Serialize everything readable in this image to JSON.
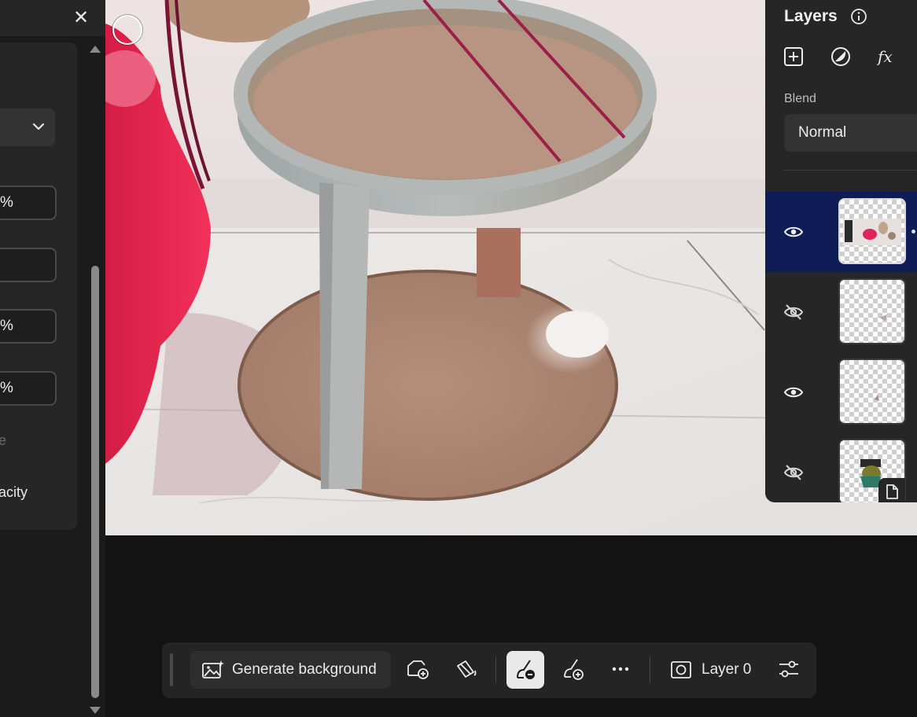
{
  "left_panel": {
    "close_label": "✕",
    "fields": [
      {
        "value": "%"
      },
      {
        "value": ""
      },
      {
        "value": "%"
      },
      {
        "value": "%"
      }
    ],
    "faint_label": "e",
    "opacity_label": "acity"
  },
  "layers_panel": {
    "title": "Layers",
    "blend_label": "Blend",
    "blend_value": "Normal",
    "layers": [
      {
        "visible": true,
        "selected": true
      },
      {
        "visible": false,
        "selected": false
      },
      {
        "visible": true,
        "selected": false
      },
      {
        "visible": false,
        "selected": false
      }
    ]
  },
  "taskbar": {
    "generate_background_label": "Generate background",
    "layer_name": "Layer 0"
  },
  "icons": {
    "close": "close-icon",
    "chevron": "chevron-down-icon",
    "info": "info-icon",
    "add_layer": "add-layer-icon",
    "adjustment": "adjustment-layer-icon",
    "effects": "fx-icon",
    "eye": "eye-icon",
    "eye_hidden": "eye-hidden-icon",
    "generate_bg": "generate-image-icon",
    "more": "more-icon",
    "layer": "layer-icon",
    "properties": "properties-sliders-icon"
  },
  "colors": {
    "selected_layer": "#0e1d55",
    "panel": "#262626",
    "canvas_bg": "#131313"
  }
}
